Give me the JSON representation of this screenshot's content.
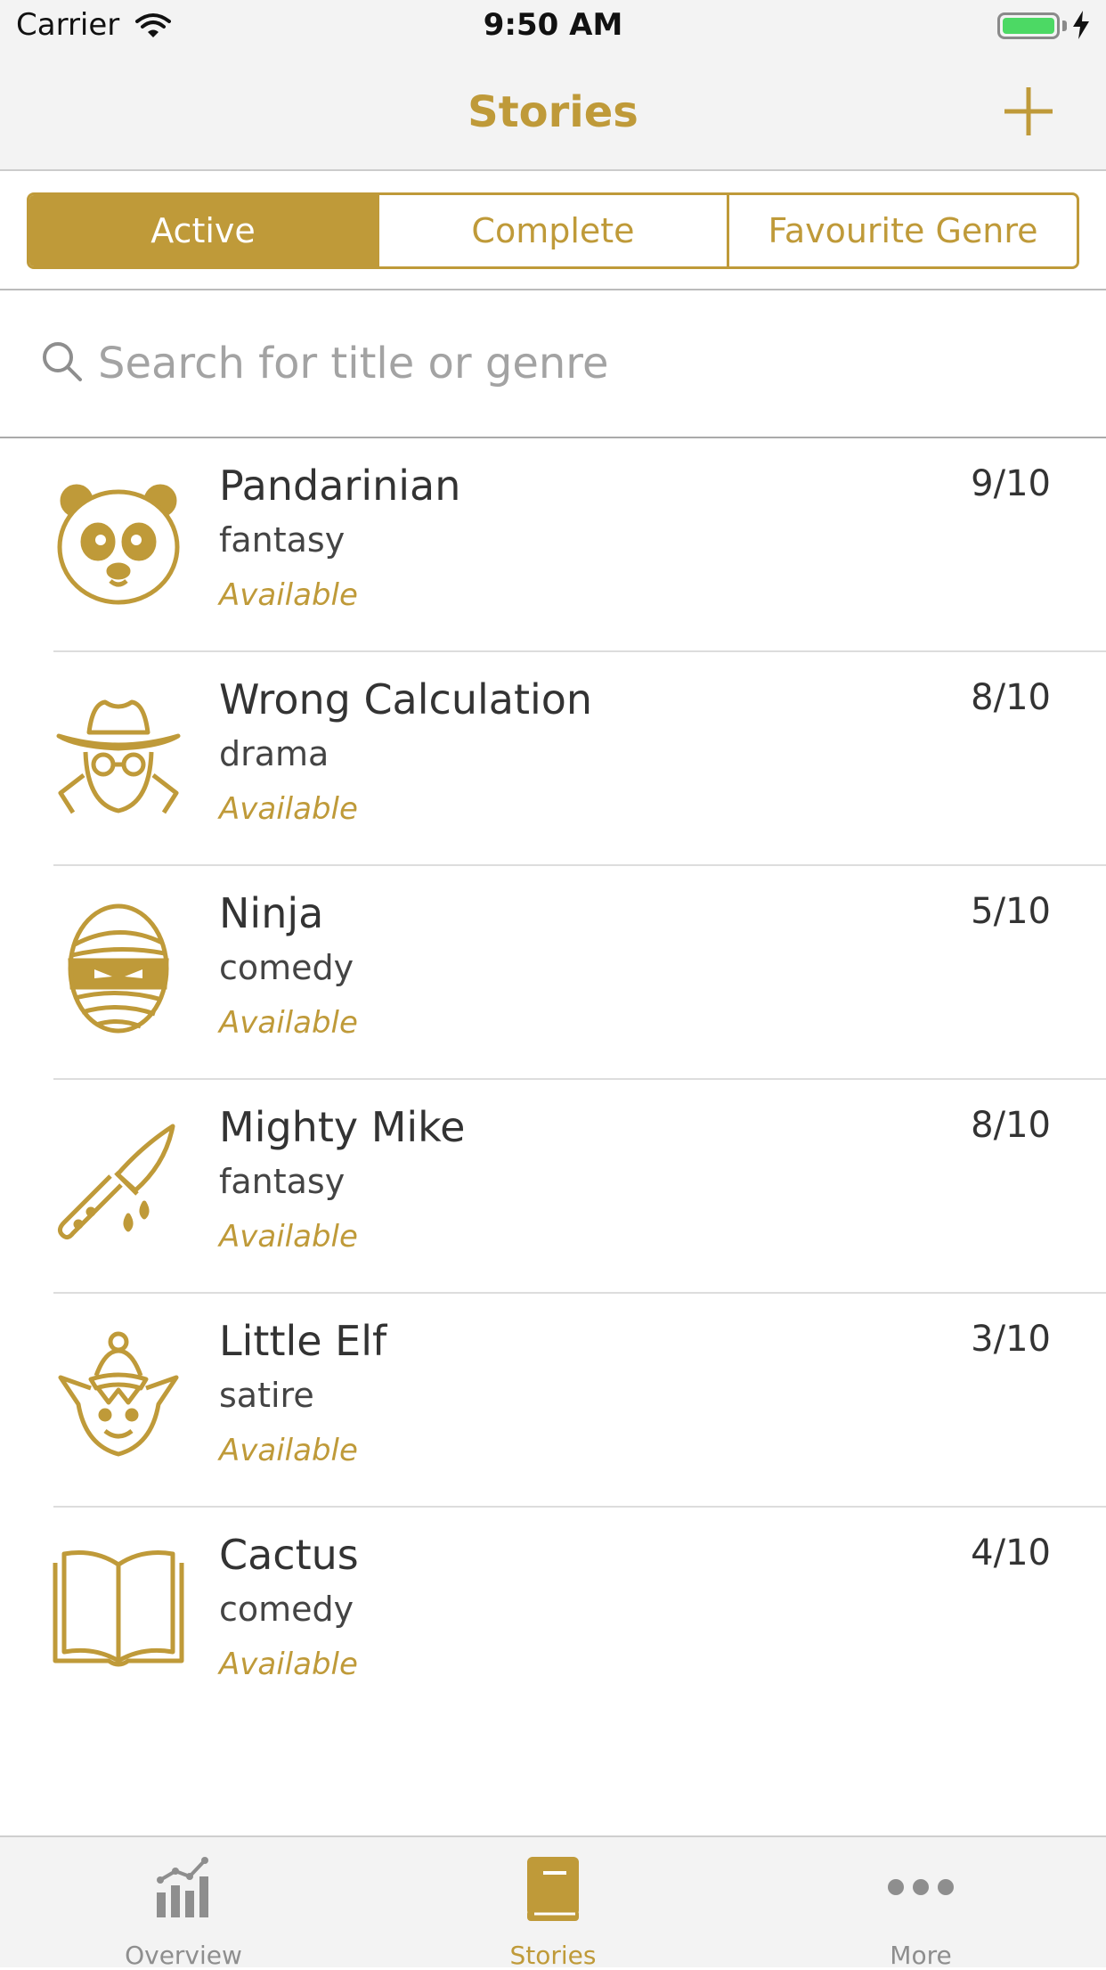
{
  "status_bar": {
    "carrier": "Carrier",
    "time": "9:50 AM",
    "battery_percent": 100
  },
  "nav": {
    "title": "Stories",
    "add_icon": "plus-icon"
  },
  "segments": [
    {
      "label": "Active",
      "selected": true
    },
    {
      "label": "Complete",
      "selected": false
    },
    {
      "label": "Favourite Genre",
      "selected": false
    }
  ],
  "search": {
    "placeholder": "Search for title or genre",
    "value": ""
  },
  "stories": [
    {
      "title": "Pandarinian",
      "genre": "fantasy",
      "status": "Available",
      "score": "9/10",
      "icon": "panda-icon"
    },
    {
      "title": "Wrong Calculation",
      "genre": "drama",
      "status": "Available",
      "score": "8/10",
      "icon": "spy-icon"
    },
    {
      "title": "Ninja",
      "genre": "comedy",
      "status": "Available",
      "score": "5/10",
      "icon": "ninja-mummy-icon"
    },
    {
      "title": "Mighty Mike",
      "genre": "fantasy",
      "status": "Available",
      "score": "8/10",
      "icon": "bloody-knife-icon"
    },
    {
      "title": "Little Elf",
      "genre": "satire",
      "status": "Available",
      "score": "3/10",
      "icon": "elf-icon"
    },
    {
      "title": "Cactus",
      "genre": "comedy",
      "status": "Available",
      "score": "4/10",
      "icon": "open-book-icon"
    }
  ],
  "tabs": [
    {
      "label": "Overview",
      "icon": "chart-icon",
      "active": false
    },
    {
      "label": "Stories",
      "icon": "book-icon",
      "active": true
    },
    {
      "label": "More",
      "icon": "more-dots-icon",
      "active": false
    }
  ],
  "colors": {
    "accent": "#bf9a39",
    "inactive_tab": "#8e8e8e",
    "battery": "#4cd964"
  }
}
